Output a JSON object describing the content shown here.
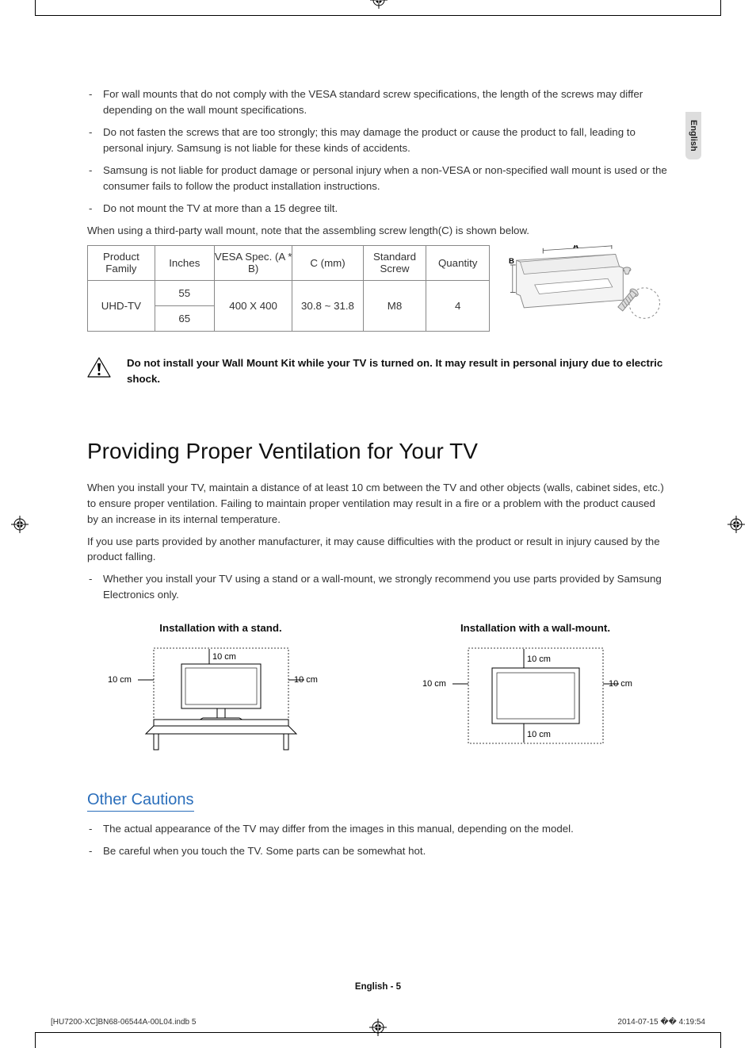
{
  "lang_tab": "English",
  "bullets_top": [
    "For wall mounts that do not comply with the VESA standard screw specifications, the length of the screws may differ depending on the wall mount specifications.",
    "Do not fasten the screws that are too strongly; this may damage the product or cause the product to fall, leading to personal injury. Samsung is not liable for these kinds of accidents.",
    "Samsung is not liable for product damage or personal injury when a non-VESA or non-specified wall mount is used or the consumer fails to follow the product installation instructions.",
    "Do not mount the TV at more than a 15 degree tilt."
  ],
  "para_above_table": "When using a third-party wall mount, note that the assembling screw length(C) is shown below.",
  "table": {
    "headers": [
      "Product Family",
      "Inches",
      "VESA Spec. (A * B)",
      "C (mm)",
      "Standard Screw",
      "Quantity"
    ],
    "product_family": "UHD-TV",
    "inch_rows": [
      "55",
      "65"
    ],
    "vesa": "400 X 400",
    "c_mm": "30.8 ~ 31.8",
    "screw": "M8",
    "qty": "4"
  },
  "bracket_labels": {
    "a": "A",
    "b": "B"
  },
  "warning_text": "Do not install your Wall Mount Kit while your TV is turned on. It may result in personal injury due to electric shock.",
  "h1": "Providing Proper Ventilation for Your TV",
  "ventilation_para1": "When you install your TV, maintain a distance of at least 10 cm between the TV and other objects (walls, cabinet sides, etc.) to ensure proper ventilation. Failing to maintain proper ventilation may result in a fire or a problem with the product caused by an increase in its internal temperature.",
  "ventilation_para2": "If you use parts provided by another manufacturer, it may cause difficulties with the product or result in injury caused by the product falling.",
  "ventilation_bullet": "Whether you install your TV using a stand or a wall-mount, we strongly recommend you use parts provided by Samsung Electronics only.",
  "install": {
    "stand_title": "Installation with a stand.",
    "wall_title": "Installation with a wall-mount.",
    "dist": "10 cm"
  },
  "h2": "Other Cautions",
  "cautions_bullets": [
    "The actual appearance of the TV may differ from the images in this manual, depending on the model.",
    "Be careful when you touch the TV. Some parts can be somewhat hot."
  ],
  "footer": {
    "center": "English - 5",
    "left": "[HU7200-XC]BN68-06544A-00L04.indb   5",
    "right": "2014-07-15   �� 4:19:54"
  }
}
